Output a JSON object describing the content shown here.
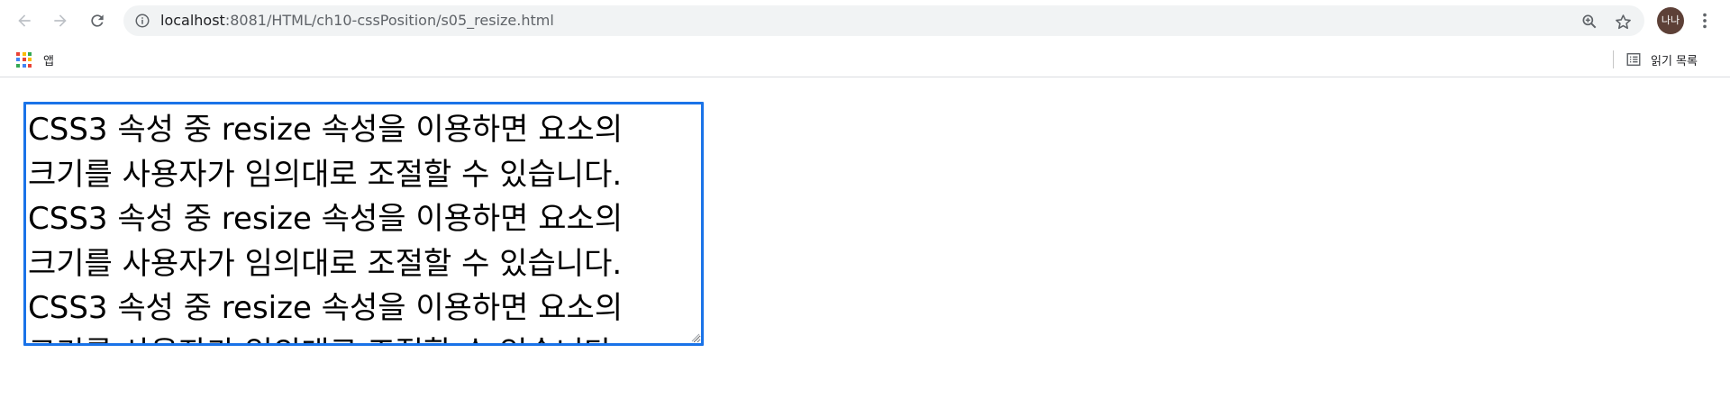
{
  "browser": {
    "url_host": "localhost",
    "url_path": ":8081/HTML/ch10-cssPosition/s05_resize.html",
    "avatar_text": "나나",
    "icons": {
      "back": "back-arrow-icon",
      "forward": "forward-arrow-icon",
      "reload": "reload-icon",
      "site_info": "info-icon",
      "zoom": "zoom-icon",
      "bookmark": "star-icon",
      "menu": "kebab-menu-icon"
    }
  },
  "bookmarks_bar": {
    "apps_label": "앱",
    "reading_list_label": "읽기 목록"
  },
  "page": {
    "resize_text": "CSS3 속성 중 resize 속성을 이용하면 요소의 크기를 사용자가 임의대로 조절할 수 있습니다. CSS3 속성 중 resize 속성을 이용하면 요소의 크기를 사용자가 임의대로 조절할 수 있습니다. CSS3 속성 중 resize 속성을 이용하면 요소의 크기를 사용자가 임의대로 조절할 수 있습니다.",
    "border_color": "#1a73e8"
  }
}
